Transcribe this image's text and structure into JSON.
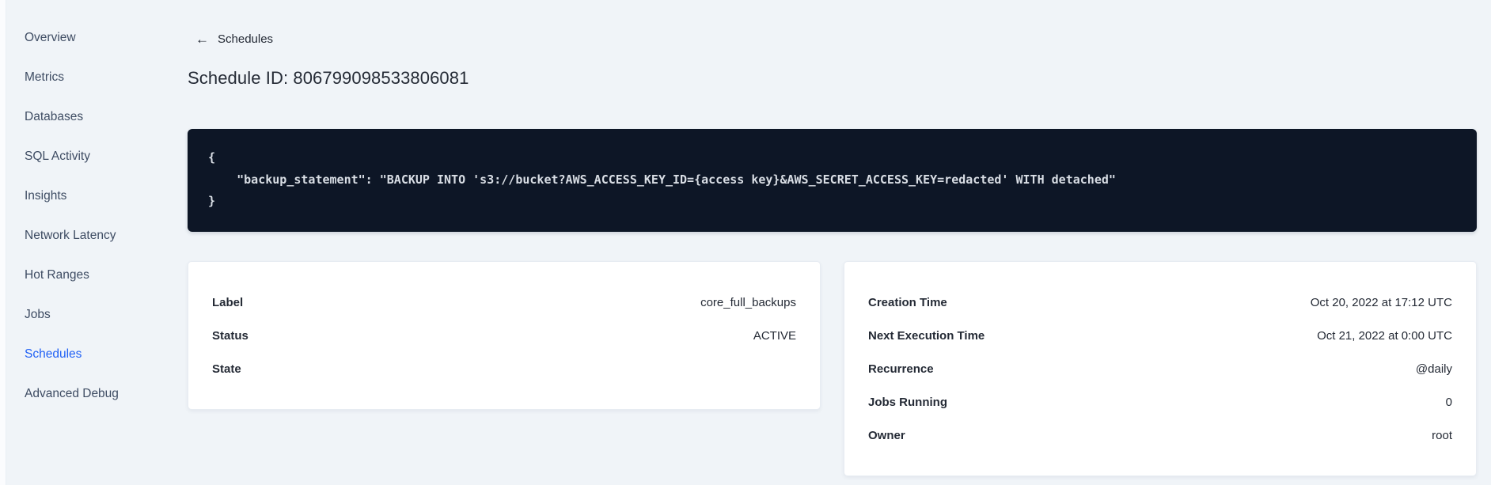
{
  "colors": {
    "background": "#f0f4f8",
    "accent_blue": "#2161f5",
    "code_background": "#0d1626",
    "code_text": "#d9dee5",
    "text_dark": "#242a35",
    "sidebar_text": "#3e4c63",
    "card_background": "#ffffff"
  },
  "icons": {
    "back_arrow": "←"
  },
  "sidebar": {
    "items": [
      {
        "label": "Overview",
        "active": false
      },
      {
        "label": "Metrics",
        "active": false
      },
      {
        "label": "Databases",
        "active": false
      },
      {
        "label": "SQL Activity",
        "active": false
      },
      {
        "label": "Insights",
        "active": false
      },
      {
        "label": "Network Latency",
        "active": false
      },
      {
        "label": "Hot Ranges",
        "active": false
      },
      {
        "label": "Jobs",
        "active": false
      },
      {
        "label": "Schedules",
        "active": true
      },
      {
        "label": "Advanced Debug",
        "active": false
      }
    ]
  },
  "header": {
    "back_label": "Schedules",
    "title": "Schedule ID: 806799098533806081"
  },
  "code_block": {
    "lines": [
      "{",
      "    \"backup_statement\": \"BACKUP INTO 's3://bucket?AWS_ACCESS_KEY_ID={access key}&AWS_SECRET_ACCESS_KEY=redacted' WITH detached\"",
      "}"
    ]
  },
  "schedule_details": {
    "left_card": {
      "rows": [
        {
          "label": "Label",
          "value": "core_full_backups"
        },
        {
          "label": "Status",
          "value": "ACTIVE"
        },
        {
          "label": "State",
          "value": ""
        }
      ]
    },
    "right_card": {
      "rows": [
        {
          "label": "Creation Time",
          "value": "Oct 20, 2022 at 17:12 UTC"
        },
        {
          "label": "Next Execution Time",
          "value": "Oct 21, 2022 at 0:00 UTC"
        },
        {
          "label": "Recurrence",
          "value": "@daily"
        },
        {
          "label": "Jobs Running",
          "value": "0"
        },
        {
          "label": "Owner",
          "value": "root"
        }
      ]
    }
  }
}
